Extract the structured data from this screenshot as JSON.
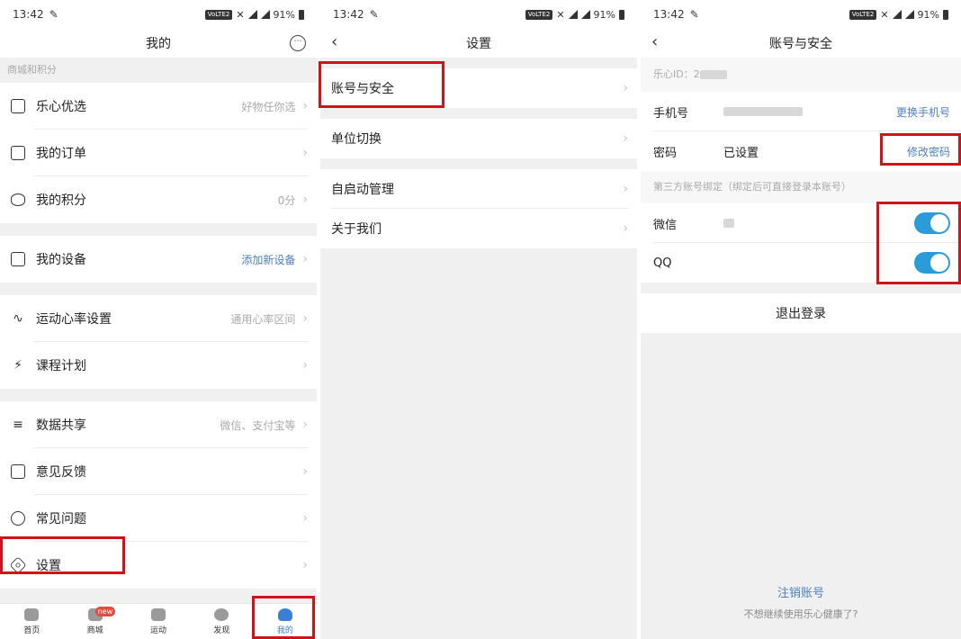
{
  "status": {
    "time": "13:42",
    "volte": "VoLTE2",
    "battery": "91%"
  },
  "screen1": {
    "title": "我的",
    "message_icon_text": "⋯",
    "section_label": "商城和积分",
    "items": [
      {
        "icon": "shop-icon",
        "label": "乐心优选",
        "value": "好物任你选"
      },
      {
        "icon": "order-icon",
        "label": "我的订单",
        "value": ""
      },
      {
        "icon": "points-icon",
        "label": "我的积分",
        "value": "0分"
      },
      {
        "icon": "device-icon",
        "label": "我的设备",
        "value": "添加新设备"
      },
      {
        "icon": "heart-rate-icon",
        "label": "运动心率设置",
        "value": "通用心率区间"
      },
      {
        "icon": "running-icon",
        "label": "课程计划",
        "value": ""
      },
      {
        "icon": "share-icon",
        "label": "数据共享",
        "value": "微信、支付宝等"
      },
      {
        "icon": "feedback-icon",
        "label": "意见反馈",
        "value": ""
      },
      {
        "icon": "faq-icon",
        "label": "常见问题",
        "value": ""
      },
      {
        "icon": "settings-icon",
        "label": "设置",
        "value": ""
      }
    ],
    "tabs": [
      {
        "label": "首页",
        "icon": "home-icon"
      },
      {
        "label": "商城",
        "icon": "mall-icon",
        "badge": "new"
      },
      {
        "label": "运动",
        "icon": "sport-icon"
      },
      {
        "label": "发现",
        "icon": "discover-icon"
      },
      {
        "label": "我的",
        "icon": "profile-icon"
      }
    ]
  },
  "screen2": {
    "title": "设置",
    "items": [
      {
        "label": "账号与安全"
      },
      {
        "label": "单位切换"
      },
      {
        "label": "自启动管理"
      },
      {
        "label": "关于我们"
      }
    ]
  },
  "screen3": {
    "title": "账号与安全",
    "id_label": "乐心ID：2",
    "phone_label": "手机号",
    "change_phone": "更换手机号",
    "password_label": "密码",
    "password_value": "已设置",
    "change_password": "修改密码",
    "third_party_label": "第三方账号绑定（绑定后可直接登录本账号）",
    "wechat_label": "微信",
    "qq_label": "QQ",
    "logout": "退出登录",
    "cancel_account": "注销账号",
    "cancel_sub": "不想继续使用乐心健康了?"
  },
  "colors": {
    "accent_blue": "#4a7fc1",
    "toggle_blue": "#2b9cd8",
    "highlight_red": "#d0121b"
  }
}
